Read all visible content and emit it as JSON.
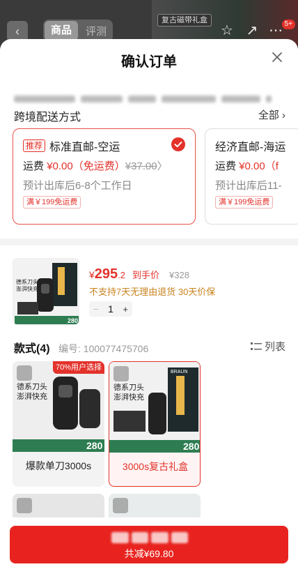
{
  "background": {
    "back_icon": "chevron-left-icon",
    "tabs": [
      {
        "label": "商品",
        "active": true
      },
      {
        "label": "评测",
        "active": false
      }
    ],
    "promo_tag": "复古磁带礼盒",
    "badge_count": "5+"
  },
  "sheet": {
    "title": "确认订单",
    "close_icon": "close-icon"
  },
  "shipping": {
    "title": "跨境配送方式",
    "all_label": "全部",
    "options": [
      {
        "badge": "推荐",
        "name": "标准直邮-空运",
        "fee_label": "运费",
        "fee": "¥0.00（免运费）",
        "original_fee": "¥37.00",
        "eta": "预计出库后6-8个工作日",
        "free_threshold": "满￥199免运费",
        "selected": true
      },
      {
        "name": "经济直邮-海运",
        "fee_label": "运费",
        "fee": "¥0.00（f",
        "eta": "预计出库后11-",
        "free_threshold": "满￥199免运费",
        "selected": false
      }
    ]
  },
  "product": {
    "price_symbol": "¥",
    "price_int": "295",
    "price_dec": ".2",
    "price_tag": "到手价",
    "original_price": "¥328",
    "policy": "不支持7天无理由退货  30天价保",
    "quantity": "1",
    "minus": "−",
    "plus": "+"
  },
  "styles": {
    "title": "款式(4)",
    "code": "编号: 100077475706",
    "list_label": "列表",
    "variants": [
      {
        "label": "爆款单刀3000s",
        "badge": "70%用户选择",
        "selected": false
      },
      {
        "label": "3000s复古礼盒",
        "selected": true
      }
    ]
  },
  "image_text": {
    "line1": "德系刀头",
    "line2": "澎湃快充",
    "price": "280",
    "brand": "BRAUN"
  },
  "checkout": {
    "discount_text": "共减¥69.80"
  },
  "colors": {
    "accent": "#e3322b",
    "pay_button": "#e8231f",
    "policy": "#c9831f"
  }
}
